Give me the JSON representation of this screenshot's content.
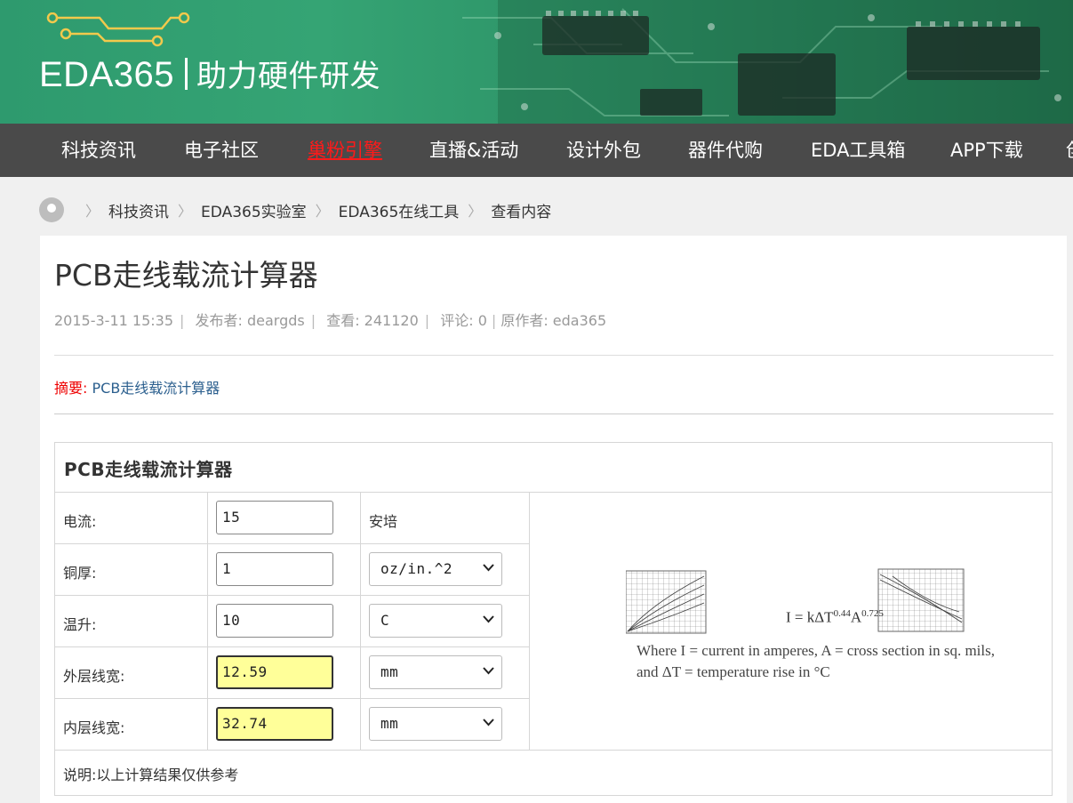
{
  "site": {
    "logo_text": "EDA365",
    "slogan": "助力硬件研发",
    "colors": {
      "banner": "#2e9a6e",
      "nav_bg": "#4a4a4a",
      "hot": "#ff1a1a"
    }
  },
  "nav": {
    "items": [
      {
        "label": "科技资讯"
      },
      {
        "label": "电子社区"
      },
      {
        "label": "巢粉引擎",
        "hot": true
      },
      {
        "label": "直播&活动"
      },
      {
        "label": "设计外包"
      },
      {
        "label": "器件代购"
      },
      {
        "label": "EDA工具箱"
      },
      {
        "label": "APP下载"
      },
      {
        "label": "创"
      }
    ]
  },
  "breadcrumb": {
    "icon": "location-pin-icon",
    "items": [
      "科技资讯",
      "EDA365实验室",
      "EDA365在线工具",
      "查看内容"
    ]
  },
  "article": {
    "title": "PCB走线载流计算器",
    "meta": {
      "date": "2015-3-11 15:35",
      "publisher": "发布者: deargds",
      "views": "查看: 241120",
      "comments": "评论: 0",
      "author": "原作者: eda365"
    },
    "summary_label": "摘要:",
    "summary_text": "PCB走线载流计算器"
  },
  "calculator": {
    "title": "PCB走线载流计算器",
    "rows": [
      {
        "label": "电流:",
        "value": "15",
        "unit": "安培",
        "unit_is_select": false,
        "result": false
      },
      {
        "label": "铜厚:",
        "value": "1",
        "unit": "oz/in.^2",
        "unit_is_select": true,
        "result": false
      },
      {
        "label": "温升:",
        "value": "10",
        "unit": "C",
        "unit_is_select": true,
        "result": false
      },
      {
        "label": "外层线宽:",
        "value": "12.59",
        "unit": "mm",
        "unit_is_select": true,
        "result": true
      },
      {
        "label": "内层线宽:",
        "value": "32.74",
        "unit": "mm",
        "unit_is_select": true,
        "result": true
      }
    ],
    "formula": {
      "eq_main": "I = kΔT",
      "eq_exp1": "0.44",
      "eq_mid": "A",
      "eq_exp2": "0.725",
      "where_line1": "Where I = current in amperes, A = cross section in sq. mils,",
      "where_line2": "and ΔT = temperature rise in °C"
    },
    "note": "说明:以上计算结果仅供参考"
  }
}
